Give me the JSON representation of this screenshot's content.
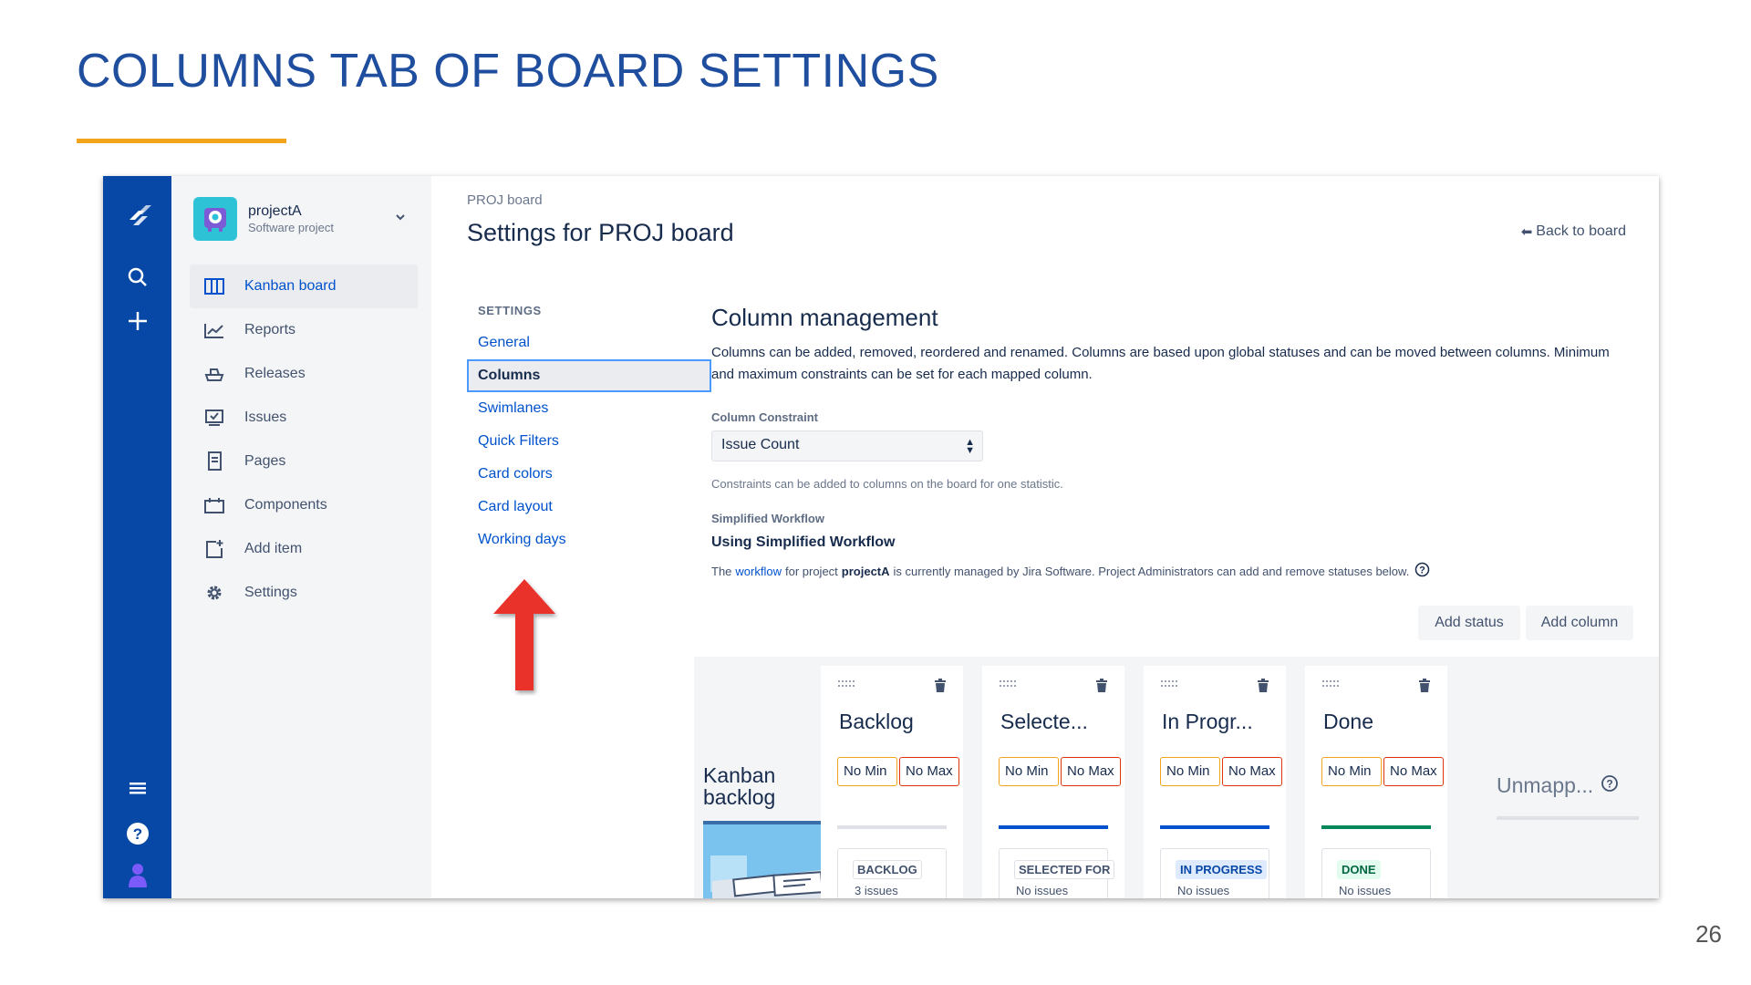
{
  "slide": {
    "title": "COLUMNS TAB OF BOARD SETTINGS",
    "page_number": "26",
    "accent_color": "#f2a41c",
    "title_color": "#1f4e9e"
  },
  "global_nav": {
    "color": "#0747a6",
    "icons": [
      "jira-logo-icon",
      "search-icon",
      "create-icon",
      "menu-icon",
      "help-icon",
      "profile-icon"
    ]
  },
  "project": {
    "name": "projectA",
    "type": "Software project"
  },
  "sidebar": {
    "items": [
      {
        "label": "Kanban board",
        "icon": "board-icon",
        "active": true
      },
      {
        "label": "Reports",
        "icon": "reports-icon"
      },
      {
        "label": "Releases",
        "icon": "releases-icon"
      },
      {
        "label": "Issues",
        "icon": "issues-icon"
      },
      {
        "label": "Pages",
        "icon": "pages-icon"
      },
      {
        "label": "Components",
        "icon": "components-icon"
      },
      {
        "label": "Add item",
        "icon": "add-item-icon"
      },
      {
        "label": "Settings",
        "icon": "settings-icon"
      }
    ]
  },
  "header": {
    "breadcrumb": "PROJ board",
    "title": "Settings for PROJ board",
    "back_link": "Back to board"
  },
  "settings_nav": {
    "heading": "SETTINGS",
    "items": [
      {
        "label": "General"
      },
      {
        "label": "Columns",
        "active": true
      },
      {
        "label": "Swimlanes"
      },
      {
        "label": "Quick Filters"
      },
      {
        "label": "Card colors"
      },
      {
        "label": "Card layout"
      },
      {
        "label": "Working days"
      }
    ]
  },
  "column_management": {
    "heading": "Column management",
    "description": "Columns can be added, removed, reordered and renamed. Columns are based upon global statuses and can be moved between columns. Minimum and maximum constraints can be set for each mapped column.",
    "constraint_label": "Column Constraint",
    "constraint_value": "Issue Count",
    "constraint_help": "Constraints can be added to columns on the board for one statistic.",
    "workflow_label": "Simplified Workflow",
    "workflow_value": "Using Simplified Workflow",
    "workflow_help_prefix": "The",
    "workflow_help_link": "workflow",
    "workflow_help_middle": "for project",
    "workflow_help_project": "projectA",
    "workflow_help_suffix": "is currently managed by Jira Software. Project Administrators can add and remove statuses below.",
    "add_status_label": "Add status",
    "add_column_label": "Add column"
  },
  "board": {
    "backlog_label": "Kanban backlog",
    "min_placeholder": "No Min",
    "max_placeholder": "No Max",
    "columns": [
      {
        "name": "Backlog",
        "status": "BACKLOG",
        "count": "3 issues",
        "bar_color": "#dfe1e6",
        "lozenge_bg": "#ffffff",
        "lozenge_color": "#42526e",
        "lozenge_border": "#dfe1e6"
      },
      {
        "name": "Selecte...",
        "status": "SELECTED FOR",
        "count": "No issues",
        "bar_color": "#0052cc",
        "lozenge_bg": "#ffffff",
        "lozenge_color": "#42526e",
        "lozenge_border": "#dfe1e6"
      },
      {
        "name": "In Progr...",
        "status": "IN PROGRESS",
        "count": "No issues",
        "bar_color": "#0052cc",
        "lozenge_bg": "#deebff",
        "lozenge_color": "#0747a6",
        "lozenge_border": "#deebff"
      },
      {
        "name": "Done",
        "status": "DONE",
        "count": "No issues",
        "bar_color": "#00875a",
        "lozenge_bg": "#e3fcef",
        "lozenge_color": "#006644",
        "lozenge_border": "#e3fcef"
      }
    ],
    "unmapped_label": "Unmapp..."
  }
}
